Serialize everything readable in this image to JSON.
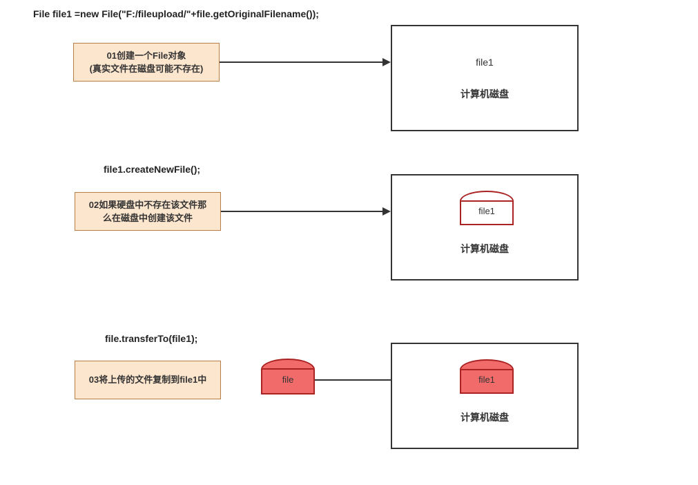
{
  "code": {
    "line1": "File file1 =new File(\"F:/fileupload/\"+file.getOriginalFilename());",
    "line2": "file1.createNewFile();",
    "line3": "file.transferTo(file1);"
  },
  "steps": {
    "s1_line1": "01创建一个File对象",
    "s1_line2": "(真实文件在磁盘可能不存在)",
    "s2_line1": "02如果硬盘中不存在该文件那",
    "s2_line2": "么在磁盘中创建该文件",
    "s3": "03将上传的文件复制到file1中"
  },
  "disk": {
    "label": "计算机磁盘",
    "file_text": "file1"
  },
  "outside_file": "file"
}
